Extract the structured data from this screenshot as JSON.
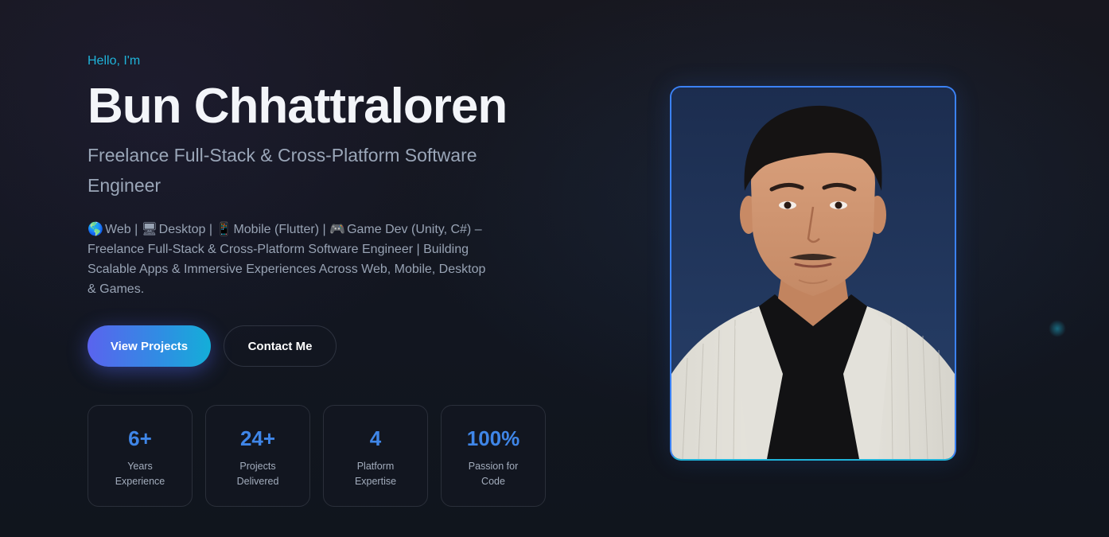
{
  "hero": {
    "greeting": "Hello, I'm",
    "name": "Bun Chhattraloren",
    "role": "Freelance Full-Stack & Cross-Platform Software Engineer",
    "platforms": [
      {
        "icon": "globe-icon",
        "glyph": "🌎",
        "label": "Web"
      },
      {
        "icon": "desktop-icon",
        "glyph": "🖥",
        "label": "Desktop"
      },
      {
        "icon": "mobile-icon",
        "glyph": "📱",
        "label": "Mobile (Flutter)"
      },
      {
        "icon": "gamepad-icon",
        "glyph": "🎮",
        "label": "Game Dev (Unity, C#)"
      }
    ],
    "separator": "|",
    "description_tail": "– Freelance Full-Stack & Cross-Platform Software Engineer | Building Scalable Apps & Immersive Experiences Across Web, Mobile, Desktop & Games."
  },
  "buttons": {
    "view_projects": "View Projects",
    "contact_me": "Contact Me"
  },
  "stats": [
    {
      "value": "6+",
      "label": "Years Experience"
    },
    {
      "value": "24+",
      "label": "Projects Delivered"
    },
    {
      "value": "4",
      "label": "Platform Expertise"
    },
    {
      "value": "100%",
      "label": "Passion for Code"
    }
  ],
  "colors": {
    "accent_cyan": "#1fb3d9",
    "accent_blue": "#3f86e8",
    "button_gradient_start": "#5a63ee",
    "button_gradient_end": "#14aed8",
    "background": "#12141d"
  }
}
